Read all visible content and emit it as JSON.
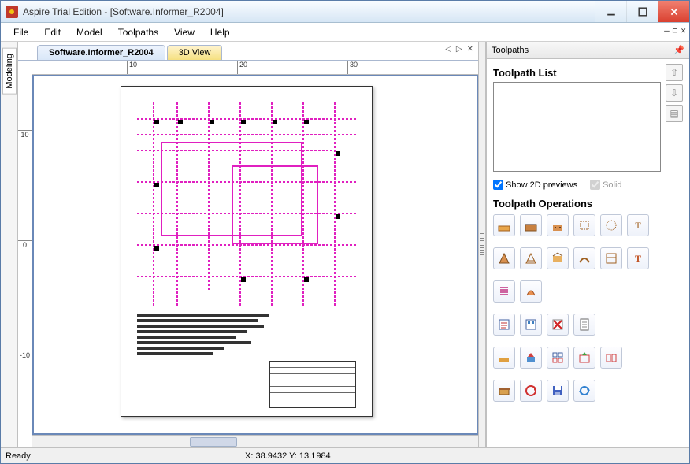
{
  "window": {
    "title": "Aspire Trial Edition - [Software.Informer_R2004]"
  },
  "menubar": {
    "items": [
      "File",
      "Edit",
      "Model",
      "Toolpaths",
      "View",
      "Help"
    ]
  },
  "left_tab": {
    "label": "Modeling"
  },
  "doc_tabs": {
    "active": "Software.Informer_R2004",
    "alt": "3D View"
  },
  "ruler_h": {
    "marks": [
      "10",
      "20",
      "30"
    ]
  },
  "ruler_v": {
    "marks": [
      "10",
      "0",
      "-10"
    ]
  },
  "right": {
    "panel_title": "Toolpaths",
    "list_title": "Toolpath List",
    "show2d": "Show 2D previews",
    "solid": "Solid",
    "ops_title": "Toolpath Operations"
  },
  "icons": {
    "ops": [
      "profile",
      "pocket",
      "drilling",
      "inlay",
      "texture",
      "text",
      "vcarve",
      "fluting",
      "prism",
      "moulding",
      "chamfer",
      "text-v",
      "thread",
      "wrap",
      "preview",
      "estimate",
      "delete",
      "summary",
      "tile",
      "merge",
      "arrange",
      "export",
      "batch",
      "material",
      "reset",
      "save",
      "recalc"
    ]
  },
  "status": {
    "ready": "Ready",
    "coord": "X: 38.9432 Y: 13.1984"
  }
}
